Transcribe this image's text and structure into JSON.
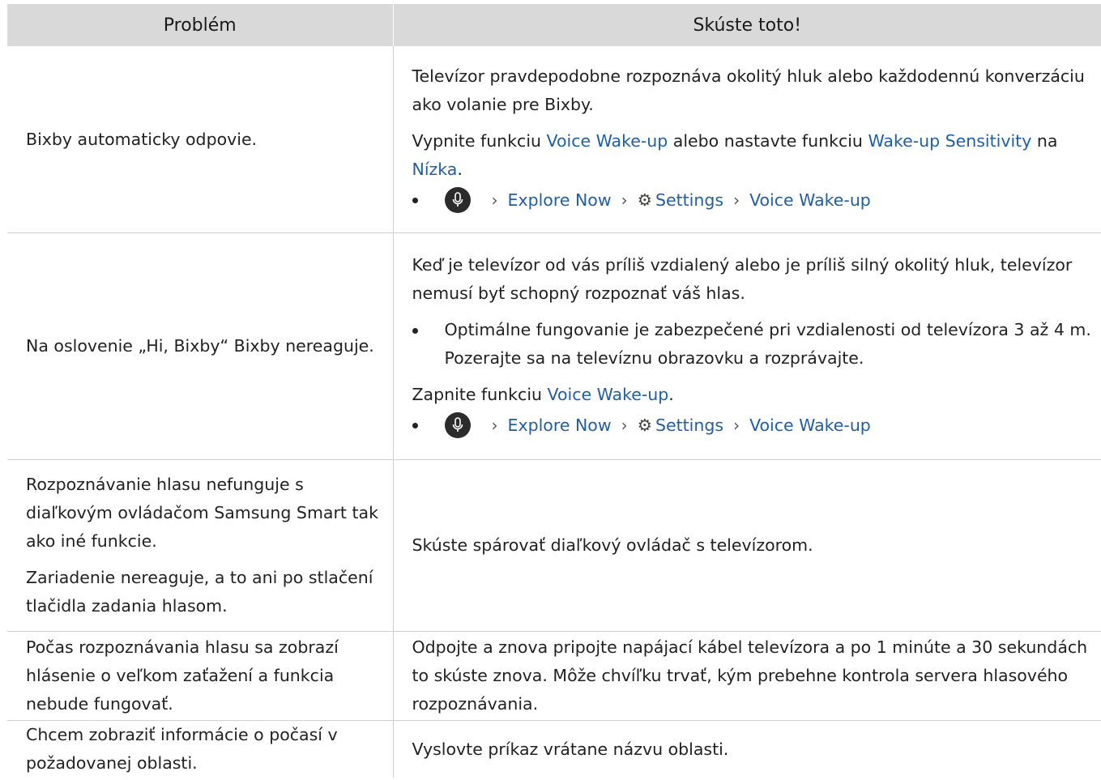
{
  "header": {
    "col1": "Problém",
    "col2": "Skúste toto!"
  },
  "rows": [
    {
      "problem": [
        "Bixby automaticky odpovie."
      ],
      "sol_text1": "Televízor pravdepodobne rozpoznáva okolitý hluk alebo každodennú konverzáciu ako volanie pre Bixby.",
      "sol_text2_a": "Vypnite funkciu ",
      "sol_text2_link1": "Voice Wake-up",
      "sol_text2_b": " alebo nastavte funkciu ",
      "sol_text2_link2": "Wake-up Sensitivity",
      "sol_text2_c": " na ",
      "sol_text2_link3": "Nízka",
      "sol_text2_d": "."
    },
    {
      "problem": [
        "Na oslovenie „Hi, Bixby“ Bixby nereaguje."
      ],
      "sol_text1": "Keď je televízor od vás príliš vzdialený alebo je príliš silný okolitý hluk, televízor nemusí byť schopný rozpoznať váš hlas.",
      "sol_bullet": "Optimálne fungovanie je zabezpečené pri vzdialenosti od televízora 3 až 4 m. Pozerajte sa na televíznu obrazovku a rozprávajte.",
      "sol_text2_a": "Zapnite funkciu ",
      "sol_text2_link1": "Voice Wake-up",
      "sol_text2_d": "."
    },
    {
      "problem": [
        "Rozpoznávanie hlasu nefunguje s diaľkovým ovládačom Samsung Smart tak ako iné funkcie.",
        "Zariadenie nereaguje, a to ani po stlačení tlačidla zadania hlasom."
      ],
      "sol_text1": "Skúste spárovať diaľkový ovládač s televízorom."
    },
    {
      "problem": [
        "Počas rozpoznávania hlasu sa zobrazí hlásenie o veľkom zaťažení a funkcia nebude fungovať."
      ],
      "sol_text1": "Odpojte a znova pripojte napájací kábel televízora a po 1 minúte a 30 sekundách to skúste znova. Môže chvíľku trvať, kým prebehne kontrola servera hlasového rozpoznávania."
    },
    {
      "problem": [
        "Chcem zobraziť informácie o počasí v požadovanej oblasti."
      ],
      "sol_text1": "Vyslovte príkaz vrátane názvu oblasti."
    }
  ],
  "path": {
    "icon_mic": "mic-icon",
    "icon_gear": "gear-icon",
    "step1": "Explore Now",
    "step2": "Settings",
    "step3": "Voice Wake-up"
  },
  "colors": {
    "header_bg": "#d9d9d9",
    "link": "#1f5fa8",
    "border": "#cfcfcf"
  }
}
